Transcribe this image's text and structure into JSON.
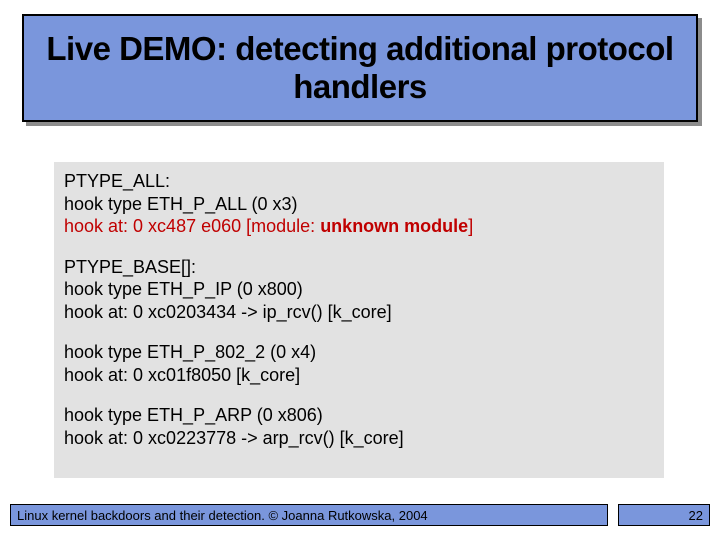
{
  "title": "Live DEMO: detecting additional protocol handlers",
  "code": {
    "block1": {
      "l1": "PTYPE_ALL:",
      "l2": "hook type ETH_P_ALL (0 x3)",
      "l3a": "hook at: 0 xc487 e060 ",
      "l3b": "[module: ",
      "l3c": "unknown module",
      "l3d": "]"
    },
    "block2": {
      "l1": "PTYPE_BASE[]:",
      "l2": "hook type ETH_P_IP (0 x800)",
      "l3": "hook at: 0 xc0203434 -> ip_rcv() [k_core]"
    },
    "block3": {
      "l1": "hook type ETH_P_802_2 (0 x4)",
      "l2": "hook at: 0 xc01f8050  [k_core]"
    },
    "block4": {
      "l1": "hook type ETH_P_ARP (0 x806)",
      "l2": "hook at: 0 xc0223778 -> arp_rcv() [k_core]"
    }
  },
  "footer": {
    "left": "Linux kernel backdoors and their detection. © Joanna Rutkowska, 2004",
    "page": "22"
  }
}
